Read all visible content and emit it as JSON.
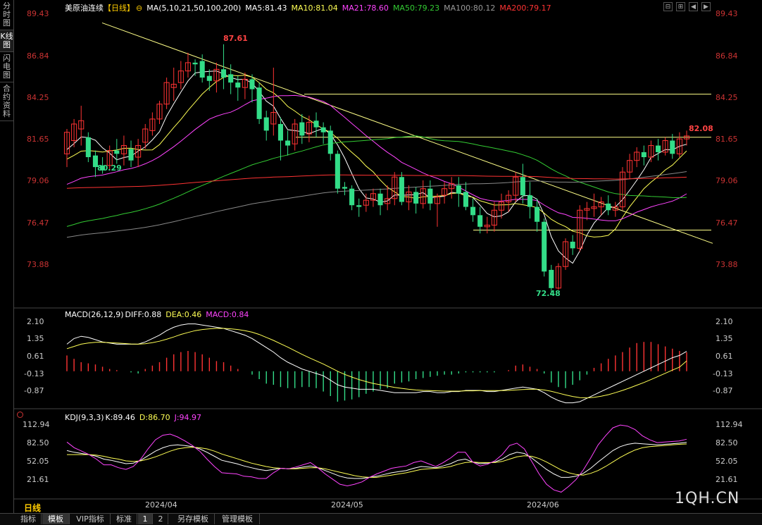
{
  "sidebar": {
    "tabs": [
      "分时图",
      "K线图",
      "闪电图",
      "合约资料"
    ]
  },
  "main": {
    "title": "美原油连续",
    "period_badge": "【日线】",
    "ma_label": "MA(5,10,21,50,100,200)",
    "ma": [
      {
        "label": "MA5:81.43",
        "color": "#ffffff"
      },
      {
        "label": "MA10:81.04",
        "color": "#ffff55"
      },
      {
        "label": "MA21:78.60",
        "color": "#ff44ff"
      },
      {
        "label": "MA50:79.23",
        "color": "#33cc33"
      },
      {
        "label": "MA100:80.12",
        "color": "#999999"
      },
      {
        "label": "MA200:79.17",
        "color": "#ff3333"
      }
    ],
    "price_ticks": [
      "89.43",
      "86.84",
      "84.25",
      "81.65",
      "79.06",
      "76.47",
      "73.88"
    ],
    "annotations": {
      "high": "87.61",
      "low": "72.48",
      "left_low": "80.29",
      "last": "82.08"
    }
  },
  "macd": {
    "label": "MACD(26,12,9)",
    "diff": "DIFF:0.88",
    "dea": "DEA:0.46",
    "macd": "MACD:0.84",
    "ticks": [
      "2.10",
      "1.35",
      "0.61",
      "-0.13",
      "-0.87"
    ]
  },
  "kdj": {
    "label": "KDJ(9,3,3)",
    "k": "K:89.46",
    "d": "D:86.70",
    "j": "J:94.97",
    "ticks": [
      "112.94",
      "82.50",
      "52.05",
      "21.61"
    ]
  },
  "xaxis": {
    "labels": [
      "2024/04",
      "2024/05",
      "2024/06"
    ]
  },
  "period_label": "日线",
  "bottombar": {
    "tabs": [
      "指标",
      "模板",
      "VIP指标",
      "标准",
      "1",
      "2",
      "另存模板",
      "管理模板"
    ]
  },
  "watermark": "1QH.CN",
  "chart_data": {
    "type": "candlestick",
    "y_range": [
      72.0,
      89.43
    ],
    "candles": [
      [
        81.0,
        82.3,
        80.2,
        82.5
      ],
      [
        81.8,
        82.8,
        81.4,
        83.1
      ],
      [
        82.5,
        83.0,
        81.5,
        83.9
      ],
      [
        82.0,
        80.8,
        80.5,
        82.3
      ],
      [
        80.9,
        80.2,
        79.6,
        81.2
      ],
      [
        80.3,
        80.0,
        79.8,
        80.8
      ],
      [
        80.3,
        81.2,
        80.0,
        81.5
      ],
      [
        81.2,
        81.0,
        80.4,
        81.9
      ],
      [
        81.0,
        81.5,
        80.3,
        82.1
      ],
      [
        81.3,
        80.6,
        80.2,
        81.8
      ],
      [
        80.8,
        81.5,
        80.2,
        81.9
      ],
      [
        81.7,
        82.5,
        81.3,
        82.8
      ],
      [
        82.4,
        83.1,
        82.1,
        83.5
      ],
      [
        83.1,
        84.0,
        82.8,
        84.2
      ],
      [
        84.0,
        85.3,
        83.7,
        85.6
      ],
      [
        85.0,
        85.2,
        84.2,
        86.2
      ],
      [
        85.3,
        86.0,
        84.9,
        86.6
      ],
      [
        86.0,
        86.5,
        85.6,
        87.1
      ],
      [
        86.5,
        86.4,
        85.7,
        86.7
      ],
      [
        86.6,
        85.6,
        85.3,
        87.0
      ],
      [
        85.7,
        85.4,
        84.8,
        86.1
      ],
      [
        85.4,
        86.1,
        84.7,
        86.5
      ],
      [
        86.1,
        85.6,
        84.9,
        87.61
      ],
      [
        85.8,
        85.3,
        84.6,
        86.4
      ],
      [
        85.3,
        85.0,
        84.2,
        85.7
      ],
      [
        85.0,
        85.5,
        84.3,
        85.9
      ],
      [
        85.5,
        84.9,
        84.1,
        85.8
      ],
      [
        85.0,
        83.1,
        82.8,
        85.3
      ],
      [
        83.2,
        82.4,
        81.8,
        83.6
      ],
      [
        82.8,
        83.5,
        82.1,
        86.2
      ],
      [
        82.8,
        81.8,
        80.6,
        83.2
      ],
      [
        81.8,
        81.5,
        80.9,
        82.4
      ],
      [
        81.6,
        82.8,
        81.2,
        83.1
      ],
      [
        82.9,
        82.1,
        81.6,
        83.4
      ],
      [
        82.2,
        82.9,
        81.7,
        83.3
      ],
      [
        83.0,
        82.6,
        82.0,
        83.5
      ],
      [
        82.6,
        82.3,
        81.6,
        82.9
      ],
      [
        82.4,
        81.0,
        80.6,
        82.7
      ],
      [
        81.0,
        78.9,
        78.6,
        81.2
      ],
      [
        79.0,
        78.9,
        78.5,
        79.3
      ],
      [
        78.9,
        77.9,
        77.6,
        79.1
      ],
      [
        77.9,
        77.8,
        77.2,
        78.3
      ],
      [
        77.9,
        78.2,
        77.5,
        78.6
      ],
      [
        78.2,
        78.6,
        77.8,
        78.9
      ],
      [
        78.6,
        77.9,
        77.3,
        78.9
      ],
      [
        78.0,
        78.3,
        77.6,
        79.1
      ],
      [
        78.3,
        79.6,
        77.9,
        79.9
      ],
      [
        79.6,
        78.1,
        77.9,
        79.9
      ],
      [
        78.1,
        78.7,
        77.6,
        79.1
      ],
      [
        78.7,
        78.0,
        77.4,
        79.0
      ],
      [
        78.0,
        78.9,
        77.7,
        79.4
      ],
      [
        78.9,
        78.0,
        77.6,
        79.4
      ],
      [
        78.0,
        78.4,
        76.6,
        78.6
      ],
      [
        78.5,
        78.9,
        78.0,
        79.3
      ],
      [
        78.9,
        79.2,
        78.3,
        79.6
      ],
      [
        79.1,
        78.6,
        77.8,
        79.6
      ],
      [
        78.7,
        77.8,
        77.6,
        79.3
      ],
      [
        77.8,
        77.3,
        76.9,
        78.3
      ],
      [
        77.3,
        76.6,
        76.2,
        77.8
      ],
      [
        76.6,
        76.7,
        76.2,
        77.2
      ],
      [
        76.7,
        77.6,
        76.3,
        78.1
      ],
      [
        77.6,
        78.1,
        77.1,
        78.6
      ],
      [
        78.1,
        78.5,
        77.5,
        78.8
      ],
      [
        78.5,
        79.6,
        78.1,
        79.9
      ],
      [
        79.6,
        78.5,
        78.0,
        80.4
      ],
      [
        78.5,
        77.8,
        77.1,
        79.3
      ],
      [
        77.8,
        76.9,
        76.3,
        78.3
      ],
      [
        76.9,
        73.9,
        73.6,
        77.1
      ],
      [
        74.0,
        72.9,
        72.48,
        74.3
      ],
      [
        72.9,
        74.2,
        72.8,
        74.4
      ],
      [
        74.2,
        75.7,
        74.0,
        75.9
      ],
      [
        75.7,
        75.3,
        74.9,
        76.1
      ],
      [
        75.3,
        77.6,
        75.1,
        77.9
      ],
      [
        77.6,
        77.7,
        77.0,
        78.1
      ],
      [
        77.7,
        77.8,
        77.2,
        78.6
      ],
      [
        77.8,
        78.1,
        77.3,
        78.4
      ],
      [
        78.0,
        77.6,
        77.3,
        78.5
      ],
      [
        77.6,
        77.8,
        77.2,
        78.1
      ],
      [
        77.8,
        79.9,
        77.6,
        80.2
      ],
      [
        79.9,
        80.6,
        79.5,
        81.0
      ],
      [
        80.6,
        81.1,
        80.2,
        81.4
      ],
      [
        81.1,
        80.8,
        80.3,
        81.5
      ],
      [
        80.8,
        81.5,
        80.5,
        81.8
      ],
      [
        81.5,
        81.1,
        80.6,
        81.9
      ],
      [
        81.1,
        81.8,
        80.9,
        82.0
      ],
      [
        81.8,
        81.0,
        80.7,
        82.2
      ],
      [
        81.0,
        81.9,
        80.8,
        82.3
      ],
      [
        81.9,
        82.08,
        81.5,
        82.4
      ]
    ],
    "macd_range": [
      -1.6,
      2.4
    ],
    "macd_hist": [
      0.7,
      0.55,
      0.4,
      0.35,
      0.3,
      0.2,
      0.1,
      0.05,
      0.0,
      -0.05,
      -0.1,
      0.1,
      0.25,
      0.4,
      0.6,
      0.75,
      0.85,
      0.9,
      0.85,
      0.75,
      0.6,
      0.45,
      0.4,
      0.25,
      0.1,
      0.0,
      -0.15,
      -0.35,
      -0.55,
      -0.6,
      -0.7,
      -0.75,
      -0.75,
      -0.7,
      -0.7,
      -0.75,
      -0.9,
      -1.1,
      -1.35,
      -1.3,
      -1.25,
      -1.15,
      -1.0,
      -0.9,
      -0.8,
      -0.75,
      -0.55,
      -0.5,
      -0.45,
      -0.35,
      -0.3,
      -0.25,
      -0.2,
      -0.15,
      -0.15,
      -0.1,
      -0.05,
      -0.05,
      -0.05,
      -0.05,
      -0.05,
      0.0,
      0.05,
      0.25,
      0.3,
      0.2,
      0.1,
      -0.1,
      -0.5,
      -0.7,
      -0.75,
      -0.6,
      -0.4,
      -0.15,
      0.15,
      0.35,
      0.55,
      0.7,
      0.85,
      1.05,
      1.25,
      1.3,
      1.3,
      1.2,
      1.1,
      1.0,
      0.9,
      0.84
    ],
    "macd_diff": [
      1.2,
      1.45,
      1.55,
      1.5,
      1.4,
      1.3,
      1.25,
      1.2,
      1.2,
      1.2,
      1.2,
      1.3,
      1.45,
      1.6,
      1.8,
      1.95,
      2.05,
      2.1,
      2.1,
      2.05,
      2.0,
      1.95,
      1.9,
      1.8,
      1.7,
      1.6,
      1.45,
      1.25,
      1.05,
      0.85,
      0.6,
      0.4,
      0.25,
      0.1,
      0.0,
      -0.1,
      -0.2,
      -0.4,
      -0.6,
      -0.7,
      -0.75,
      -0.8,
      -0.8,
      -0.8,
      -0.85,
      -0.9,
      -0.95,
      -0.95,
      -0.95,
      -0.95,
      -0.9,
      -0.9,
      -0.95,
      -0.95,
      -0.9,
      -0.9,
      -0.85,
      -0.85,
      -0.85,
      -0.9,
      -0.9,
      -0.85,
      -0.8,
      -0.75,
      -0.7,
      -0.75,
      -0.8,
      -0.95,
      -1.15,
      -1.3,
      -1.4,
      -1.4,
      -1.35,
      -1.2,
      -1.05,
      -0.9,
      -0.75,
      -0.6,
      -0.45,
      -0.3,
      -0.15,
      0.0,
      0.15,
      0.3,
      0.45,
      0.6,
      0.7,
      0.88
    ],
    "macd_dea": [
      1.0,
      1.1,
      1.2,
      1.25,
      1.28,
      1.28,
      1.27,
      1.25,
      1.23,
      1.21,
      1.2,
      1.22,
      1.27,
      1.33,
      1.42,
      1.52,
      1.63,
      1.72,
      1.8,
      1.85,
      1.88,
      1.9,
      1.9,
      1.88,
      1.85,
      1.8,
      1.73,
      1.63,
      1.5,
      1.37,
      1.22,
      1.07,
      0.91,
      0.75,
      0.6,
      0.46,
      0.32,
      0.16,
      0.0,
      -0.14,
      -0.26,
      -0.37,
      -0.46,
      -0.54,
      -0.6,
      -0.66,
      -0.72,
      -0.76,
      -0.8,
      -0.83,
      -0.85,
      -0.86,
      -0.87,
      -0.88,
      -0.88,
      -0.88,
      -0.87,
      -0.87,
      -0.86,
      -0.86,
      -0.86,
      -0.86,
      -0.85,
      -0.83,
      -0.81,
      -0.8,
      -0.8,
      -0.83,
      -0.89,
      -0.97,
      -1.05,
      -1.12,
      -1.17,
      -1.18,
      -1.16,
      -1.11,
      -1.04,
      -0.95,
      -0.85,
      -0.74,
      -0.62,
      -0.5,
      -0.37,
      -0.23,
      -0.09,
      0.05,
      0.18,
      0.46
    ],
    "kdj_range": [
      0,
      130
    ],
    "kdj_k": [
      75,
      72,
      70,
      68,
      65,
      60,
      58,
      55,
      52,
      53,
      58,
      66,
      74,
      80,
      84,
      85,
      84,
      82,
      78,
      72,
      65,
      58,
      55,
      52,
      48,
      45,
      42,
      40,
      42,
      44,
      43,
      44,
      46,
      48,
      45,
      40,
      35,
      30,
      27,
      26,
      26,
      28,
      30,
      33,
      36,
      38,
      40,
      44,
      47,
      46,
      45,
      48,
      52,
      58,
      60,
      55,
      52,
      53,
      55,
      60,
      68,
      72,
      70,
      62,
      52,
      42,
      34,
      28,
      28,
      30,
      35,
      44,
      55,
      65,
      75,
      82,
      86,
      88,
      87,
      86,
      85,
      86,
      87,
      88,
      89.46
    ],
    "kdj_d": [
      68,
      68,
      68,
      68,
      67,
      65,
      62,
      60,
      57,
      56,
      57,
      60,
      64,
      69,
      74,
      78,
      80,
      81,
      80,
      78,
      74,
      69,
      65,
      61,
      57,
      53,
      50,
      47,
      45,
      44,
      43,
      43,
      44,
      45,
      45,
      43,
      40,
      37,
      34,
      31,
      29,
      28,
      28,
      30,
      32,
      34,
      36,
      39,
      42,
      43,
      44,
      45,
      47,
      51,
      54,
      55,
      54,
      54,
      54,
      56,
      60,
      64,
      66,
      65,
      61,
      55,
      48,
      41,
      36,
      33,
      32,
      35,
      40,
      47,
      55,
      63,
      70,
      76,
      80,
      82,
      83,
      84,
      85,
      86,
      86.7
    ],
    "kdj_j": [
      90,
      80,
      74,
      68,
      60,
      50,
      50,
      45,
      42,
      47,
      60,
      78,
      94,
      102,
      104,
      99,
      92,
      84,
      74,
      60,
      47,
      36,
      35,
      34,
      30,
      29,
      26,
      26,
      36,
      44,
      43,
      46,
      50,
      54,
      45,
      34,
      25,
      16,
      13,
      16,
      20,
      28,
      34,
      39,
      44,
      46,
      48,
      54,
      57,
      52,
      47,
      54,
      62,
      72,
      72,
      55,
      48,
      51,
      57,
      68,
      84,
      88,
      78,
      56,
      34,
      16,
      6,
      2,
      12,
      24,
      41,
      62,
      85,
      101,
      115,
      120,
      118,
      112,
      101,
      94,
      89,
      90,
      91,
      92,
      94.97
    ],
    "reference_lines": [
      84.6,
      82.0,
      76.4
    ]
  }
}
